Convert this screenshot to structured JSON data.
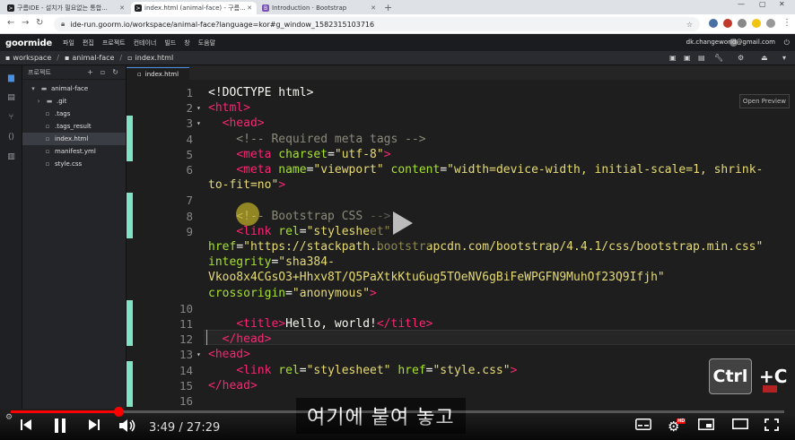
{
  "browser": {
    "tabs": [
      {
        "title": "구름IDE - 설치가 필요없는 통합...",
        "favicon": "terminal-icon",
        "active": false
      },
      {
        "title": "index.html (animal-face) - 구름...",
        "favicon": "terminal-icon",
        "active": true
      },
      {
        "title": "Introduction · Bootstrap",
        "favicon": "bootstrap-icon",
        "active": false
      }
    ],
    "url": "ide-run.goorm.io/workspace/animal-face?language=kor#g_window_1582315103716",
    "bootstrap_color": "#7952b3"
  },
  "ide": {
    "logo": "goormide",
    "menu": [
      "파일",
      "편집",
      "프로젝트",
      "컨테이너",
      "빌드",
      "창",
      "도움말"
    ],
    "account": "dk.changeworld@gmail.com",
    "breadcrumb": [
      "workspace",
      "animal-face",
      "index.html"
    ],
    "tree_header": "프로젝트",
    "tree": [
      {
        "name": "animal-face",
        "type": "folder-open"
      },
      {
        "name": ".git",
        "type": "folder"
      },
      {
        "name": ".tags",
        "type": "file"
      },
      {
        "name": ".tags_result",
        "type": "file"
      },
      {
        "name": "index.html",
        "type": "file",
        "selected": true
      },
      {
        "name": "manifest.yml",
        "type": "file"
      },
      {
        "name": "style.css",
        "type": "file"
      }
    ],
    "editor_tab": "index.html",
    "open_preview": "Open Preview",
    "accent": "#4a90e2"
  },
  "code_lines": [
    {
      "n": "1",
      "fold": "",
      "segs": [
        {
          "c": "tx",
          "t": "<!DOCTYPE html>"
        }
      ]
    },
    {
      "n": "2",
      "fold": "▾",
      "segs": [
        {
          "c": "tg",
          "t": "<html>"
        }
      ]
    },
    {
      "n": "3",
      "fold": "▾",
      "segs": [
        {
          "c": "tx",
          "t": "  "
        },
        {
          "c": "tg",
          "t": "<head>"
        }
      ]
    },
    {
      "n": "4",
      "fold": "",
      "segs": [
        {
          "c": "cm",
          "t": "    <!-- Required meta tags -->"
        }
      ]
    },
    {
      "n": "5",
      "fold": "",
      "segs": [
        {
          "c": "tx",
          "t": "    "
        },
        {
          "c": "tg",
          "t": "<meta "
        },
        {
          "c": "at",
          "t": "charset"
        },
        {
          "c": "tx",
          "t": "="
        },
        {
          "c": "sv",
          "t": "\"utf-8\""
        },
        {
          "c": "tg",
          "t": ">"
        }
      ]
    },
    {
      "n": "6",
      "fold": "",
      "segs": [
        {
          "c": "tx",
          "t": "    "
        },
        {
          "c": "tg",
          "t": "<meta "
        },
        {
          "c": "at",
          "t": "name"
        },
        {
          "c": "tx",
          "t": "="
        },
        {
          "c": "sv",
          "t": "\"viewport\""
        },
        {
          "c": "at",
          "t": " content"
        },
        {
          "c": "tx",
          "t": "="
        },
        {
          "c": "sv",
          "t": "\"width=device-width, initial-scale=1, shrink-"
        }
      ]
    },
    {
      "n": "",
      "fold": "",
      "segs": [
        {
          "c": "sv",
          "t": "to-fit=no\""
        },
        {
          "c": "tg",
          "t": ">"
        }
      ]
    },
    {
      "n": "7",
      "fold": "",
      "segs": []
    },
    {
      "n": "8",
      "fold": "",
      "segs": [
        {
          "c": "cm",
          "t": "    <!-- Bootstrap CSS -->"
        }
      ]
    },
    {
      "n": "9",
      "fold": "",
      "segs": [
        {
          "c": "tx",
          "t": "    "
        },
        {
          "c": "tg",
          "t": "<link "
        },
        {
          "c": "at",
          "t": "rel"
        },
        {
          "c": "tx",
          "t": "="
        },
        {
          "c": "sv",
          "t": "\"stylesheet\""
        }
      ]
    },
    {
      "n": "",
      "fold": "",
      "segs": [
        {
          "c": "at",
          "t": "href"
        },
        {
          "c": "tx",
          "t": "="
        },
        {
          "c": "sv",
          "t": "\"https://stackpath.bootstrapcdn.com/bootstrap/4.4.1/css/bootstrap.min.css\""
        }
      ]
    },
    {
      "n": "",
      "fold": "",
      "segs": [
        {
          "c": "at",
          "t": "integrity"
        },
        {
          "c": "tx",
          "t": "="
        },
        {
          "c": "sv",
          "t": "\"sha384-"
        }
      ]
    },
    {
      "n": "",
      "fold": "",
      "segs": [
        {
          "c": "sv",
          "t": "Vkoo8x4CGsO3+Hhxv8T/Q5PaXtkKtu6ug5TOeNV6gBiFeWPGFN9MuhOf23Q9Ifjh\""
        }
      ]
    },
    {
      "n": "",
      "fold": "",
      "segs": [
        {
          "c": "at",
          "t": "crossorigin"
        },
        {
          "c": "tx",
          "t": "="
        },
        {
          "c": "sv",
          "t": "\"anonymous\""
        },
        {
          "c": "tg",
          "t": ">"
        }
      ]
    },
    {
      "n": "10",
      "fold": "",
      "segs": []
    },
    {
      "n": "11",
      "fold": "",
      "segs": [
        {
          "c": "tx",
          "t": "    "
        },
        {
          "c": "tg",
          "t": "<title>"
        },
        {
          "c": "tx",
          "t": "Hello, world!"
        },
        {
          "c": "tg",
          "t": "</title>"
        }
      ]
    },
    {
      "n": "12",
      "fold": "",
      "segs": [
        {
          "c": "tx",
          "t": "  "
        },
        {
          "c": "tg",
          "t": "</head>"
        }
      ]
    },
    {
      "n": "13",
      "fold": "▾",
      "segs": [
        {
          "c": "tg",
          "t": "<head>"
        }
      ]
    },
    {
      "n": "14",
      "fold": "",
      "segs": [
        {
          "c": "tx",
          "t": "    "
        },
        {
          "c": "tg",
          "t": "<link "
        },
        {
          "c": "at",
          "t": "rel"
        },
        {
          "c": "tx",
          "t": "="
        },
        {
          "c": "sv",
          "t": "\"stylesheet\""
        },
        {
          "c": "at",
          "t": " href"
        },
        {
          "c": "tx",
          "t": "="
        },
        {
          "c": "sv",
          "t": "\"style.css\""
        },
        {
          "c": "tg",
          "t": ">"
        }
      ]
    },
    {
      "n": "15",
      "fold": "",
      "segs": [
        {
          "c": "tg",
          "t": "</head>"
        }
      ]
    },
    {
      "n": "16",
      "fold": "",
      "segs": []
    }
  ],
  "video": {
    "current_time": "3:49",
    "duration": "27:29",
    "time_sep": " / ",
    "progress": 0.139,
    "subtitle": "여기에 붙여 놓고",
    "key_badge": "Ctrl",
    "plus": "+C",
    "hd": "HD"
  }
}
